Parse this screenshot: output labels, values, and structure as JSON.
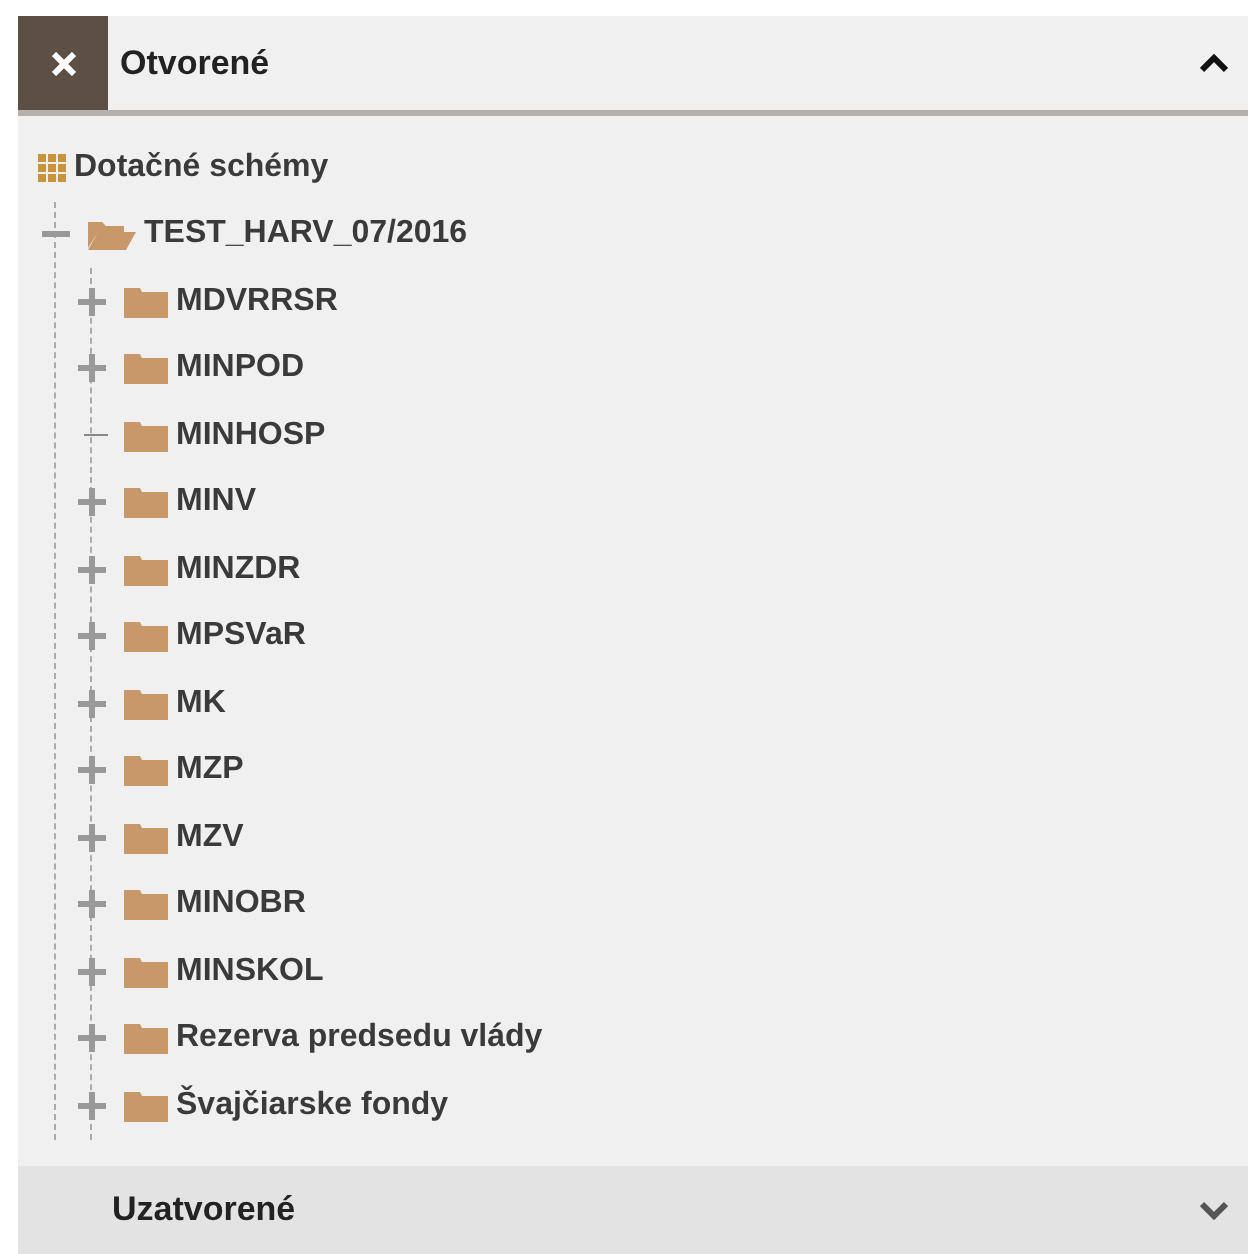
{
  "sections": [
    {
      "title": "Otvorené",
      "expanded": true,
      "tree": [
        {
          "label": "Dotačné schémy",
          "kind": "root",
          "children": [
            {
              "label": "TEST_HARV_07/2016",
              "kind": "branch",
              "expanded": true,
              "children": [
                {
                  "label": "MDVRRSR",
                  "kind": "branch",
                  "expanded": false
                },
                {
                  "label": "MINPOD",
                  "kind": "branch",
                  "expanded": false
                },
                {
                  "label": "MINHOSP",
                  "kind": "leaf"
                },
                {
                  "label": "MINV",
                  "kind": "branch",
                  "expanded": false
                },
                {
                  "label": "MINZDR",
                  "kind": "branch",
                  "expanded": false
                },
                {
                  "label": "MPSVaR",
                  "kind": "branch",
                  "expanded": false
                },
                {
                  "label": "MK",
                  "kind": "branch",
                  "expanded": false
                },
                {
                  "label": "MZP",
                  "kind": "branch",
                  "expanded": false
                },
                {
                  "label": "MZV",
                  "kind": "branch",
                  "expanded": false
                },
                {
                  "label": "MINOBR",
                  "kind": "branch",
                  "expanded": false
                },
                {
                  "label": "MINSKOL",
                  "kind": "branch",
                  "expanded": false
                },
                {
                  "label": "Rezerva predsedu vlády",
                  "kind": "branch",
                  "expanded": false
                },
                {
                  "label": "Švajčiarske fondy",
                  "kind": "branch",
                  "expanded": false
                }
              ]
            }
          ]
        }
      ]
    },
    {
      "title": "Uzatvorené",
      "expanded": false
    }
  ]
}
